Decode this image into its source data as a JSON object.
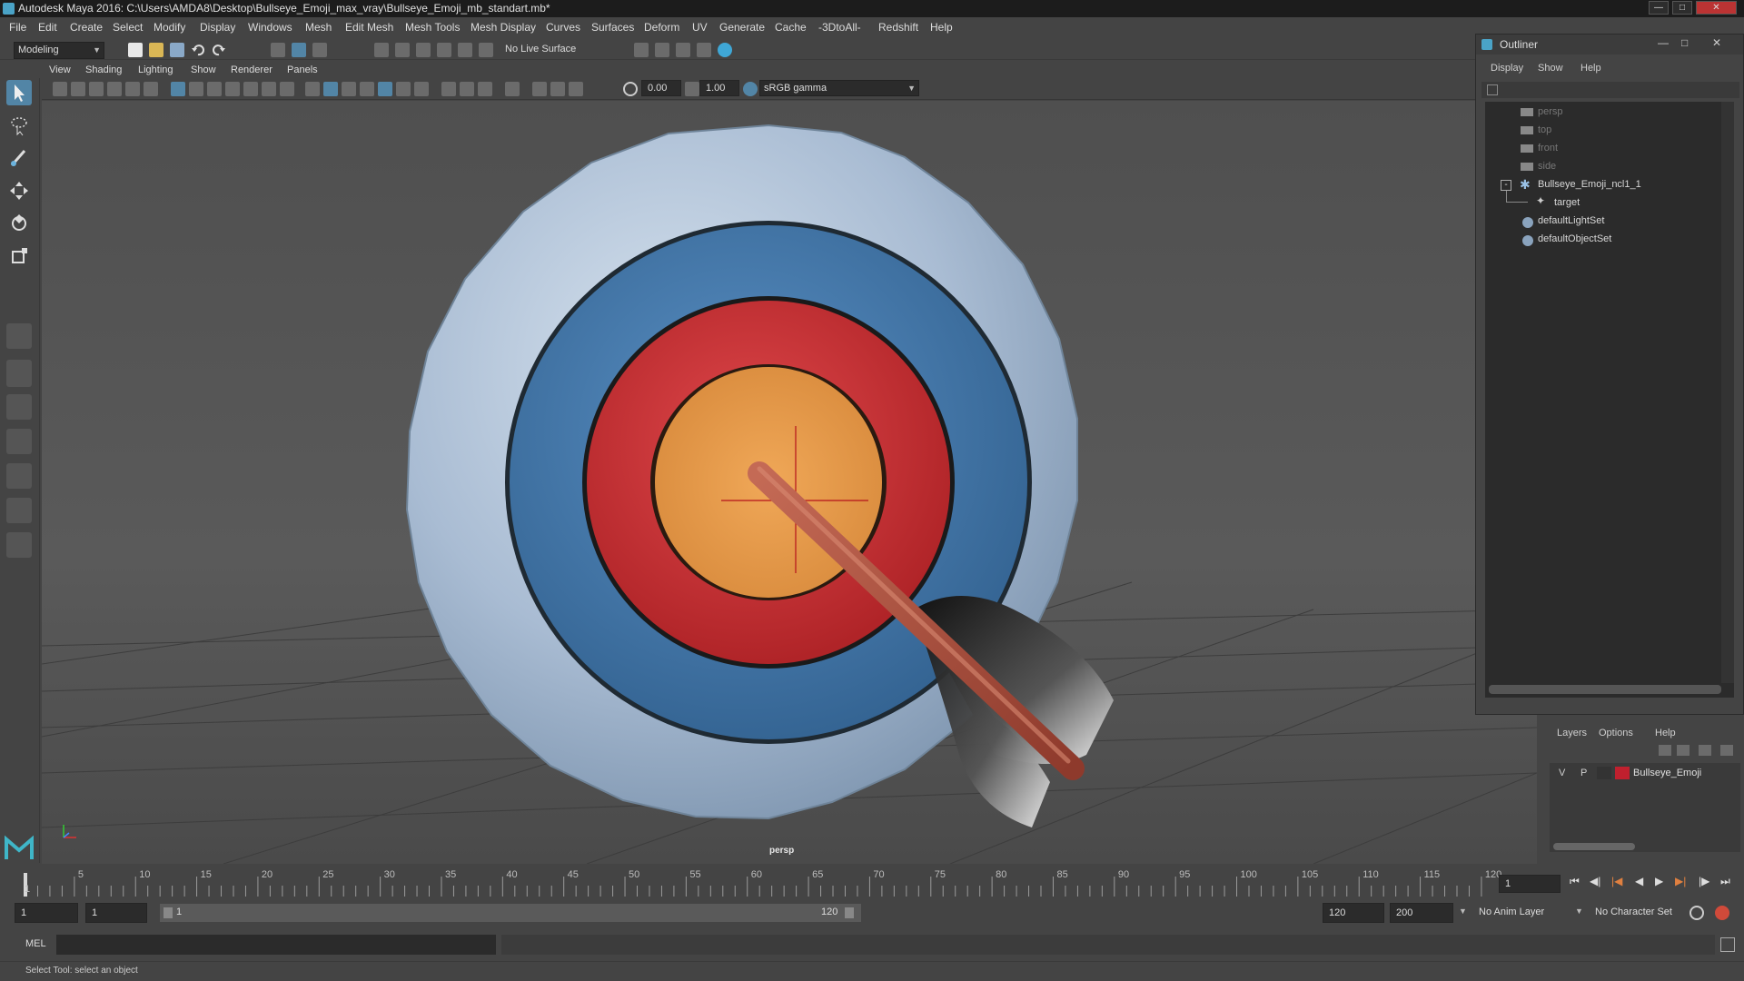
{
  "window": {
    "title": "Autodesk Maya 2016: C:\\Users\\AMDA8\\Desktop\\Bullseye_Emoji_max_vray\\Bullseye_Emoji_mb_standart.mb*"
  },
  "menubar": [
    "File",
    "Edit",
    "Create",
    "Select",
    "Modify",
    "Display",
    "Windows",
    "Mesh",
    "Edit Mesh",
    "Mesh Tools",
    "Mesh Display",
    "Curves",
    "Surfaces",
    "Deform",
    "UV",
    "Generate",
    "Cache",
    "-3DtoAll-",
    "Redshift",
    "Help"
  ],
  "statusline": {
    "mode": "Modeling",
    "live_surface": "No Live Surface"
  },
  "panel": {
    "menus": [
      "View",
      "Shading",
      "Lighting",
      "Show",
      "Renderer",
      "Panels"
    ],
    "exposure": "0.00",
    "gamma": "1.00",
    "colorspace": "sRGB gamma",
    "camera_label": "persp"
  },
  "outliner": {
    "title": "Outliner",
    "menus": [
      "Display",
      "Show",
      "Help"
    ],
    "items": [
      {
        "label": "persp",
        "dim": true
      },
      {
        "label": "top",
        "dim": true
      },
      {
        "label": "front",
        "dim": true
      },
      {
        "label": "side",
        "dim": true
      },
      {
        "label": "Bullseye_Emoji_ncl1_1",
        "dim": false
      },
      {
        "label": "target",
        "dim": false
      },
      {
        "label": "defaultLightSet",
        "dim": false
      },
      {
        "label": "defaultObjectSet",
        "dim": false
      }
    ]
  },
  "layers": {
    "menus": [
      "Layers",
      "Options",
      "Help"
    ],
    "row": {
      "v": "V",
      "p": "P",
      "name": "Bullseye_Emoji",
      "color": "#c0202e"
    }
  },
  "timeslider": {
    "ticks": [
      "5",
      "10",
      "15",
      "20",
      "25",
      "30",
      "35",
      "40",
      "45",
      "50",
      "55",
      "60",
      "65",
      "70",
      "75",
      "80",
      "85",
      "90",
      "95",
      "100",
      "105",
      "110",
      "115",
      "120"
    ],
    "start_label": "1",
    "current_frame": "1"
  },
  "rangeslider": {
    "start": "1",
    "playback_start": "1",
    "range_start": "1",
    "range_end": "120",
    "playback_end": "120",
    "end": "200",
    "anim_layer": "No Anim Layer",
    "character_set": "No Character Set"
  },
  "cmdline": {
    "label": "MEL"
  },
  "helpline": {
    "text": "Select Tool: select an object"
  },
  "colors": {
    "accent": "#5285a6",
    "ring_outer": "#a9bcd3",
    "ring_blue": "#3f74a8",
    "ring_red": "#c1282c",
    "center": "#e09a4a",
    "arrow_shaft": "#a04a3a"
  }
}
